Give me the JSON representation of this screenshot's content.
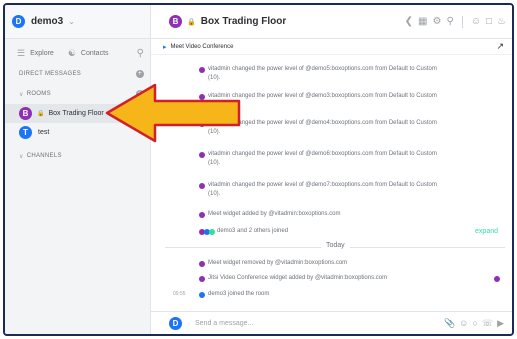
{
  "workspace": {
    "name": "demo3",
    "avatar_letter": "D"
  },
  "sidebar": {
    "explore_label": "Explore",
    "contacts_label": "Contacts",
    "sections": {
      "direct_messages": "DIRECT MESSAGES",
      "rooms": "ROOMS",
      "channels": "CHANNELS"
    },
    "rooms": [
      {
        "avatar_letter": "B",
        "label": "Box Trading Floor",
        "active": true,
        "private": true
      },
      {
        "avatar_letter": "T",
        "label": "test",
        "active": false,
        "private": false
      }
    ]
  },
  "header": {
    "room_avatar_letter": "B",
    "room_title": "Box Trading Floor"
  },
  "banner": {
    "title": "Meet Video Conference"
  },
  "messages": [
    {
      "text": "vitadmin changed the power level of @demo5:boxoptions.com from Default to Custom (10)."
    },
    {
      "text": "vitadmin changed the power level of @demo3:boxoptions.com from Default to Custom (10)."
    },
    {
      "text": "vitadmin changed the power level of @demo4:boxoptions.com from Default to Custom (10)."
    },
    {
      "text": "vitadmin changed the power level of @demo6:boxoptions.com from Default to Custom (10)."
    },
    {
      "text": "vitadmin changed the power level of @demo7:boxoptions.com from Default to Custom (10)."
    },
    {
      "text": "Meet widget added by @vitadmin:boxoptions.com"
    },
    {
      "text": "demo3 and 2 others joined",
      "expand_label": "expand"
    },
    {
      "text": "Meet widget removed by @vitadmin:boxoptions.com"
    },
    {
      "text": "Jitsi Video Conference widget added by @vitadmin:boxoptions.com"
    },
    {
      "text": "demo3 joined the room",
      "time": "09:55"
    }
  ],
  "divider_label": "Today",
  "composer": {
    "placeholder": "Send a message..."
  },
  "colors": {
    "accent_blue": "#1d74f5",
    "room_purple": "#8e2fb5",
    "expand_green": "#2de0a5",
    "arrow_yellow": "#f6b619",
    "arrow_stroke": "#d0202a",
    "frame_border": "#1b2a55"
  },
  "icons": {
    "header": [
      "share-icon",
      "grid-icon",
      "settings-icon",
      "search-icon",
      "user-icon",
      "files-icon",
      "bell-icon"
    ],
    "composer": [
      "attach-icon",
      "emoji-icon",
      "sticker-icon",
      "call-icon",
      "video-icon"
    ]
  }
}
